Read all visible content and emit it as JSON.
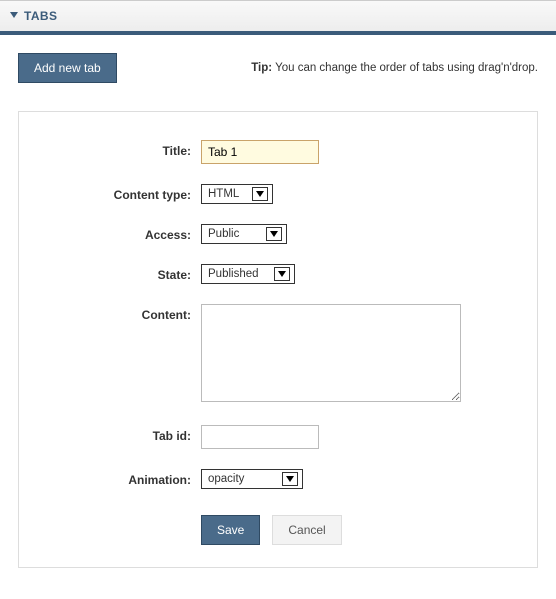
{
  "panel": {
    "title": "TABS"
  },
  "topbar": {
    "add_label": "Add new tab",
    "tip_prefix": "Tip:",
    "tip_text": "You can change the order of tabs using drag'n'drop."
  },
  "form": {
    "title_label": "Title:",
    "title_value": "Tab 1",
    "content_type_label": "Content type:",
    "content_type_value": "HTML",
    "access_label": "Access:",
    "access_value": "Public",
    "state_label": "State:",
    "state_value": "Published",
    "content_label": "Content:",
    "content_value": "",
    "tabid_label": "Tab id:",
    "tabid_value": "",
    "animation_label": "Animation:",
    "animation_value": "opacity",
    "save_label": "Save",
    "cancel_label": "Cancel"
  }
}
